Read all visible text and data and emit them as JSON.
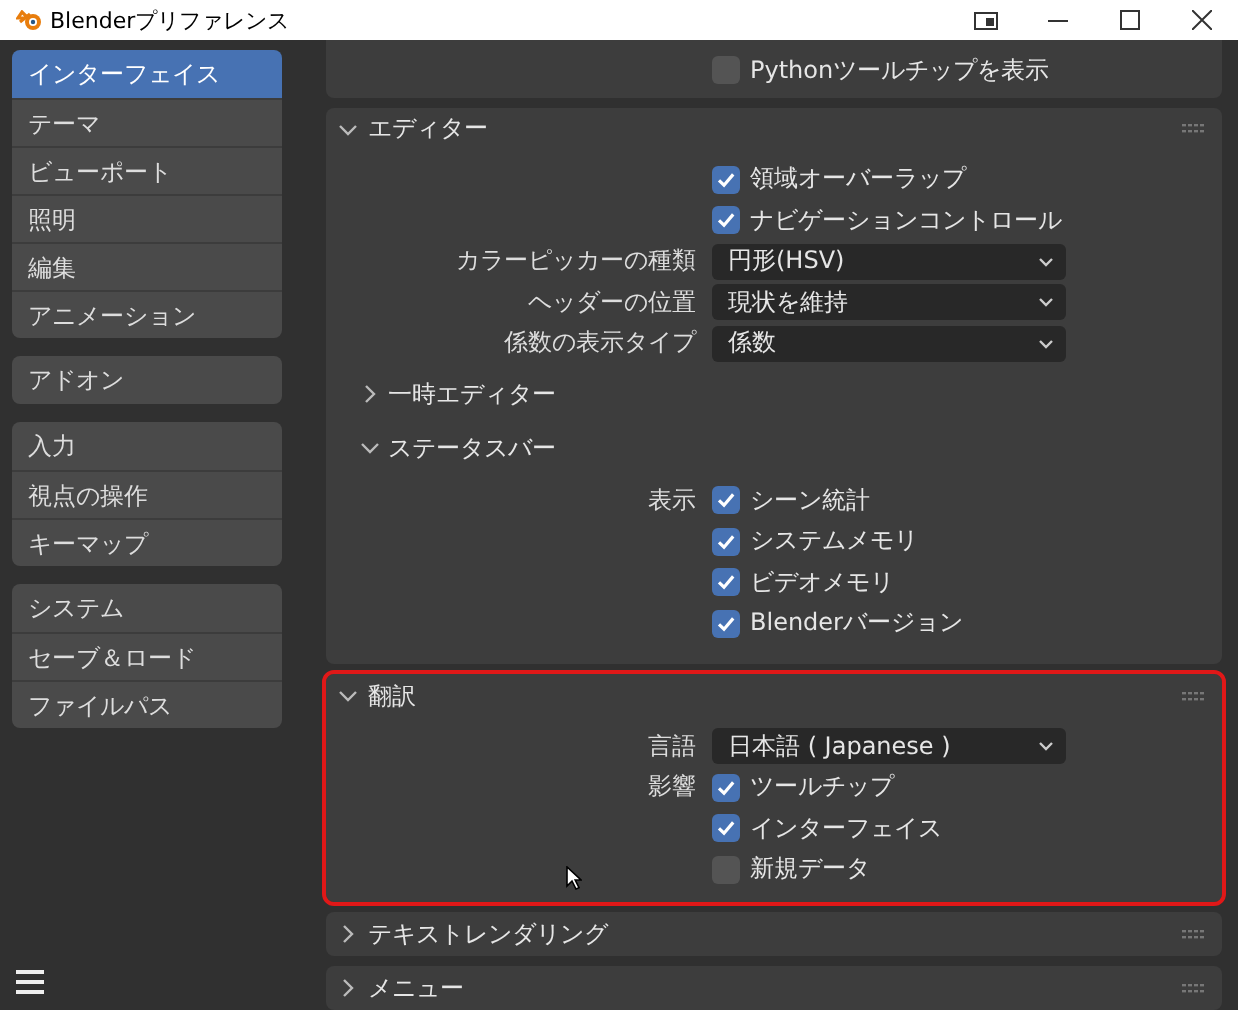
{
  "window": {
    "title": "Blenderプリファレンス"
  },
  "sidebar": {
    "groups": [
      {
        "items": [
          {
            "label": "インターフェイス",
            "selected": true
          },
          {
            "label": "テーマ",
            "selected": false
          },
          {
            "label": "ビューポート",
            "selected": false
          },
          {
            "label": "照明",
            "selected": false
          },
          {
            "label": "編集",
            "selected": false
          },
          {
            "label": "アニメーション",
            "selected": false
          }
        ]
      },
      {
        "items": [
          {
            "label": "アドオン",
            "selected": false
          }
        ]
      },
      {
        "items": [
          {
            "label": "入力",
            "selected": false
          },
          {
            "label": "視点の操作",
            "selected": false
          },
          {
            "label": "キーマップ",
            "selected": false
          }
        ]
      },
      {
        "items": [
          {
            "label": "システム",
            "selected": false
          },
          {
            "label": "セーブ＆ロード",
            "selected": false
          },
          {
            "label": "ファイルパス",
            "selected": false
          }
        ]
      }
    ]
  },
  "panels": [
    {
      "rows": [
        {
          "kind": "checkbox",
          "text": "Pythonツールチップを表示",
          "checked": false
        }
      ]
    },
    {
      "title": "エディター",
      "expanded": true,
      "highlighted": false,
      "rows": [
        {
          "kind": "checkbox",
          "text": "領域オーバーラップ",
          "checked": true
        },
        {
          "kind": "checkbox",
          "text": "ナビゲーションコントロール",
          "checked": true
        },
        {
          "kind": "dropdown",
          "label": "カラーピッカーの種類",
          "value": "円形(HSV)"
        },
        {
          "kind": "dropdown",
          "label": "ヘッダーの位置",
          "value": "現状を維持"
        },
        {
          "kind": "dropdown",
          "label": "係数の表示タイプ",
          "value": "係数"
        },
        {
          "kind": "subsection",
          "title": "一時エディター",
          "expanded": false
        },
        {
          "kind": "subsection",
          "title": "ステータスバー",
          "expanded": true,
          "rows": [
            {
              "kind": "checkbox",
              "label": "表示",
              "text": "シーン統計",
              "checked": true
            },
            {
              "kind": "checkbox",
              "text": "システムメモリ",
              "checked": true
            },
            {
              "kind": "checkbox",
              "text": "ビデオメモリ",
              "checked": true
            },
            {
              "kind": "checkbox",
              "text": "Blenderバージョン",
              "checked": true
            }
          ]
        }
      ]
    },
    {
      "title": "翻訳",
      "expanded": true,
      "highlighted": true,
      "rows": [
        {
          "kind": "dropdown",
          "label": "言語",
          "value": "日本語 ( Japanese )"
        },
        {
          "kind": "checkbox",
          "label": "影響",
          "text": "ツールチップ",
          "checked": true
        },
        {
          "kind": "checkbox",
          "text": "インターフェイス",
          "checked": true
        },
        {
          "kind": "checkbox",
          "text": "新規データ",
          "checked": false
        }
      ]
    },
    {
      "title": "テキストレンダリング",
      "expanded": false,
      "highlighted": false
    },
    {
      "title": "メニュー",
      "expanded": false,
      "highlighted": false
    }
  ]
}
